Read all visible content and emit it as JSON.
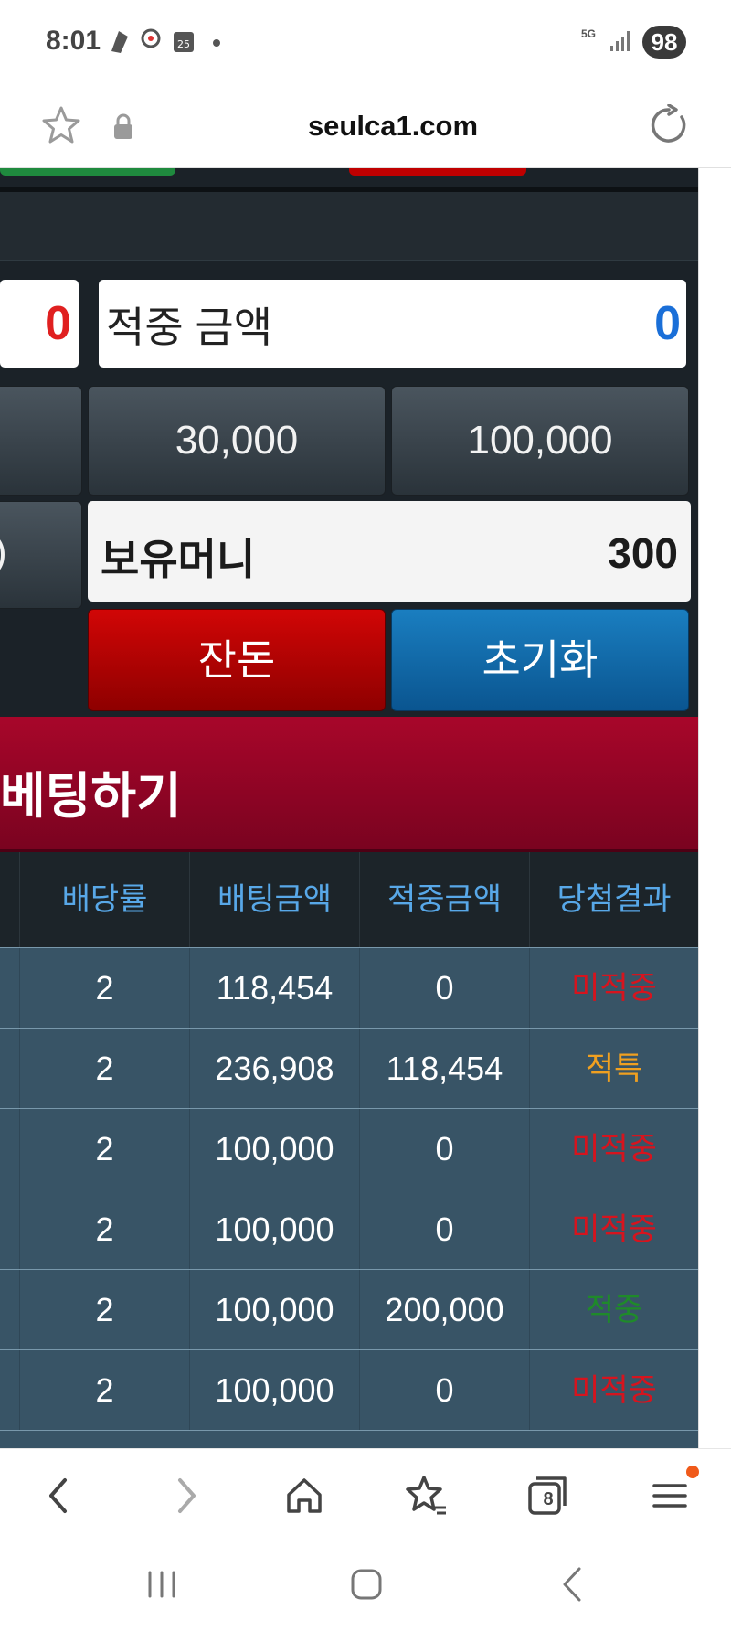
{
  "status": {
    "time": "8:01",
    "battery": "98",
    "network": "5G"
  },
  "browser": {
    "url": "seulca1.com",
    "tab_count": "8"
  },
  "summary": {
    "left_value": "0",
    "hit_amount_label": "적중 금액",
    "hit_amount_value": "0",
    "chip_30000": "30,000",
    "chip_100000": "100,000",
    "held_money_label": "보유머니",
    "held_money_value": "300",
    "change_button": "잔돈",
    "reset_button": "초기화"
  },
  "bet_section": {
    "title": "베팅하기"
  },
  "table": {
    "headers": [
      "배당률",
      "배팅금액",
      "적중금액",
      "당첨결과"
    ],
    "rows": [
      {
        "odds": "2",
        "bet": "118,454",
        "win": "0",
        "result": "미적중",
        "result_color": "#d6141e"
      },
      {
        "odds": "2",
        "bet": "236,908",
        "win": "118,454",
        "result": "적특",
        "result_color": "#f0a020"
      },
      {
        "odds": "2",
        "bet": "100,000",
        "win": "0",
        "result": "미적중",
        "result_color": "#d6141e"
      },
      {
        "odds": "2",
        "bet": "100,000",
        "win": "0",
        "result": "미적중",
        "result_color": "#d6141e"
      },
      {
        "odds": "2",
        "bet": "100,000",
        "win": "200,000",
        "result": "적중",
        "result_color": "#1f8a2a"
      },
      {
        "odds": "2",
        "bet": "100,000",
        "win": "0",
        "result": "미적중",
        "result_color": "#d6141e"
      }
    ]
  },
  "colors": {
    "hit_value": "#1a6fd8",
    "left_value": "#e02020"
  }
}
